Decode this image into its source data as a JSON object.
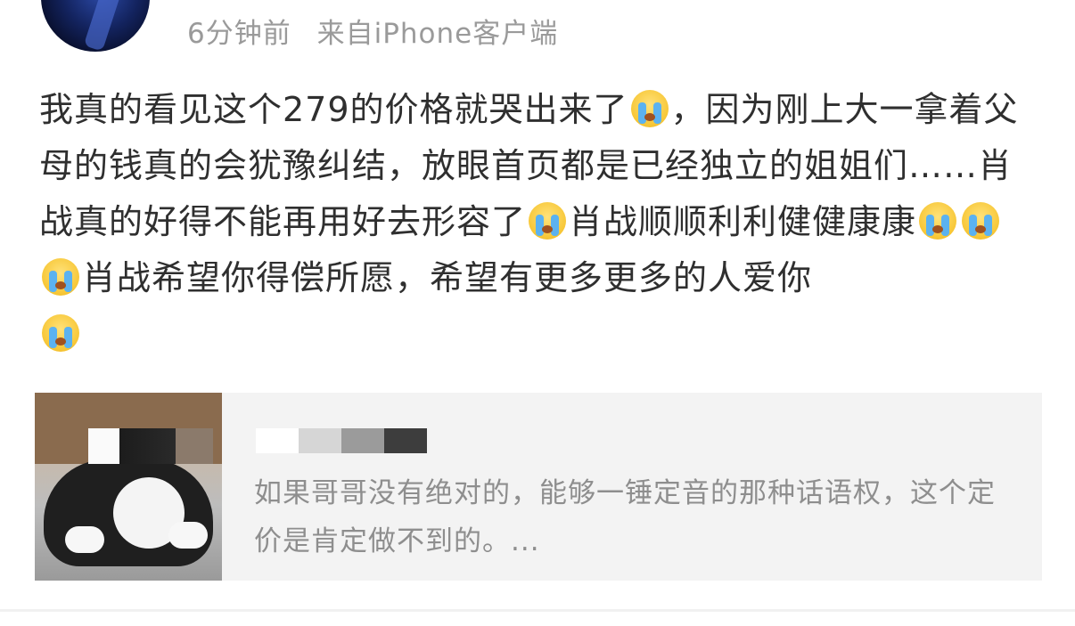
{
  "header": {
    "time": "6分钟前",
    "source": "来自iPhone客户端"
  },
  "post": {
    "seg1": "我真的看见这个279的价格就哭出来了",
    "seg2": "，因为刚上大一拿着父母的钱真的会犹豫纠结，放眼首页都是已经独立的姐姐们……肖战真的好得不能再用好去形容了",
    "seg3": "肖战顺顺利利健健康康",
    "seg4": "肖战希望你得偿所愿，希望有更多更多的人爱你",
    "emoji": "crying-face-icon"
  },
  "card": {
    "text": "如果哥哥没有绝对的，能够一锤定音的那种话语权，这个定价是肯定做不到的。..."
  }
}
